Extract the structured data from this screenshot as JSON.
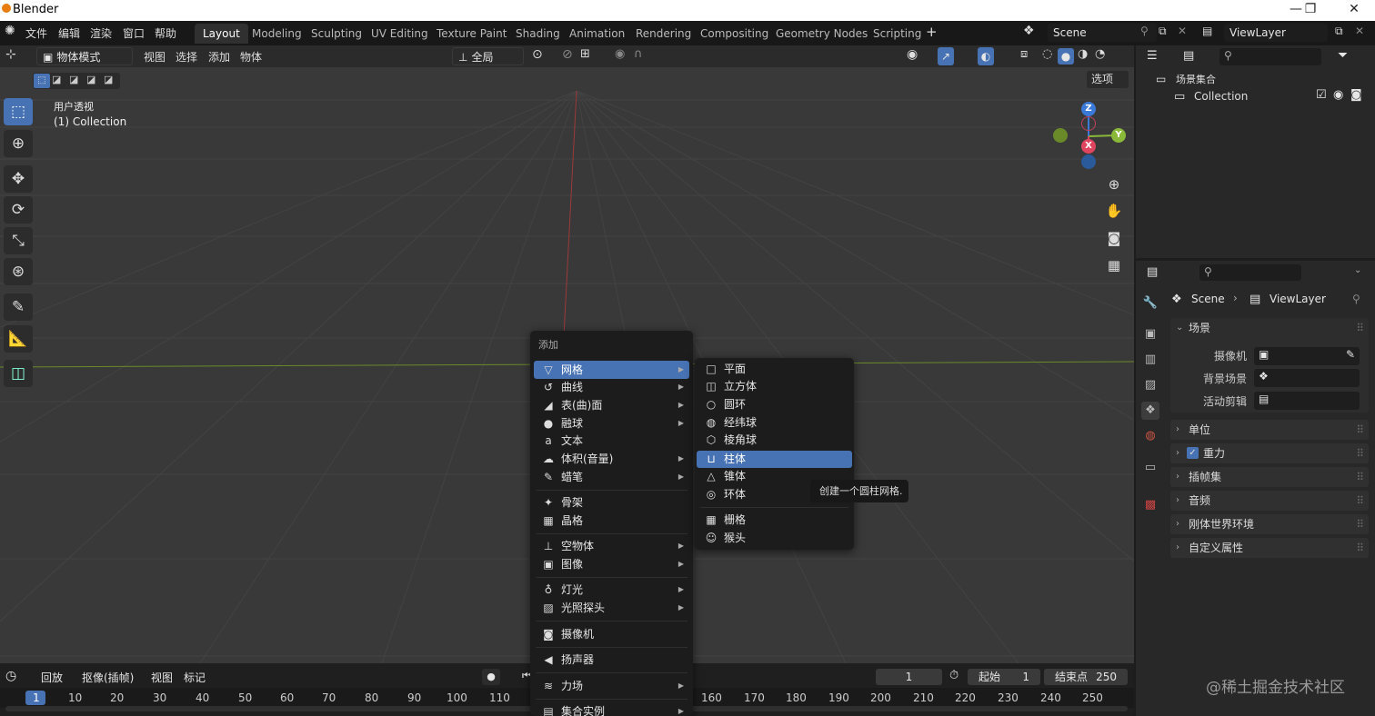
{
  "window": {
    "title": "Blender",
    "controls": [
      "—",
      "❐",
      "✕"
    ]
  },
  "menubar": {
    "items": [
      "文件",
      "编辑",
      "渲染",
      "窗口",
      "帮助"
    ]
  },
  "workspaces": [
    {
      "label": "Layout",
      "active": true
    },
    {
      "label": "Modeling"
    },
    {
      "label": "Sculpting"
    },
    {
      "label": "UV Editing"
    },
    {
      "label": "Texture Paint"
    },
    {
      "label": "Shading"
    },
    {
      "label": "Animation"
    },
    {
      "label": "Rendering"
    },
    {
      "label": "Compositing"
    },
    {
      "label": "Geometry Nodes"
    },
    {
      "label": "Scripting"
    }
  ],
  "scene": {
    "name": "Scene"
  },
  "viewlayer": {
    "name": "ViewLayer"
  },
  "viewport_header": {
    "mode": "物体模式",
    "menus": [
      "视图",
      "选择",
      "添加",
      "物体"
    ],
    "transform_orientation": "全局",
    "options": "选项"
  },
  "viewport": {
    "view_name": "用户透视",
    "collection_label": "(1) Collection"
  },
  "gizmo": {
    "z": "Z",
    "y": "Y",
    "x": "X"
  },
  "timeline": {
    "playback": "回放",
    "keying": "抠像(插帧)",
    "menus": [
      "视图",
      "标记"
    ],
    "current_frame": "1",
    "start_label": "起始",
    "start": "1",
    "end_label": "结束点",
    "end": "250",
    "frame_ticks": [
      "1",
      "10",
      "20",
      "30",
      "40",
      "50",
      "60",
      "70",
      "80",
      "90",
      "100",
      "110",
      "160",
      "170",
      "180",
      "190",
      "200",
      "210",
      "220",
      "230",
      "240",
      "250"
    ]
  },
  "outliner": {
    "scene_collection": "场景集合",
    "collection": "Collection"
  },
  "properties": {
    "breadcrumb_scene": "Scene",
    "breadcrumb_layer": "ViewLayer",
    "scene_panel": "场景",
    "camera_label": "摄像机",
    "bg_scene_label": "背景场景",
    "active_clip_label": "活动剪辑",
    "panels": [
      "单位",
      "重力",
      "插帧集",
      "音频",
      "刚体世界环境",
      "自定义属性"
    ]
  },
  "add_menu": {
    "title": "添加",
    "items": [
      {
        "label": "网格",
        "icon": "▽",
        "sub": true,
        "highlight": true
      },
      {
        "label": "曲线",
        "icon": "↺",
        "sub": true
      },
      {
        "label": "表(曲)面",
        "icon": "◢",
        "sub": true
      },
      {
        "label": "融球",
        "icon": "●",
        "sub": true
      },
      {
        "label": "文本",
        "icon": "a",
        "sub": false
      },
      {
        "label": "体积(音量)",
        "icon": "☁",
        "sub": true
      },
      {
        "label": "蜡笔",
        "icon": "✎",
        "sub": true
      },
      {
        "label": "骨架",
        "icon": "✦",
        "sub": false
      },
      {
        "label": "晶格",
        "icon": "▦",
        "sub": false
      },
      {
        "label": "空物体",
        "icon": "⊥",
        "sub": true
      },
      {
        "label": "图像",
        "icon": "▣",
        "sub": true
      },
      {
        "label": "灯光",
        "icon": "♁",
        "sub": true
      },
      {
        "label": "光照探头",
        "icon": "▨",
        "sub": true
      },
      {
        "label": "摄像机",
        "icon": "◙",
        "sub": false
      },
      {
        "label": "扬声器",
        "icon": "◀",
        "sub": false
      },
      {
        "label": "力场",
        "icon": "≋",
        "sub": true
      },
      {
        "label": "集合实例",
        "icon": "▤",
        "sub": true
      }
    ]
  },
  "mesh_submenu": {
    "items": [
      {
        "label": "平面",
        "icon": "□"
      },
      {
        "label": "立方体",
        "icon": "◫"
      },
      {
        "label": "圆环",
        "icon": "○"
      },
      {
        "label": "经纬球",
        "icon": "◍"
      },
      {
        "label": "棱角球",
        "icon": "⬡"
      },
      {
        "label": "柱体",
        "icon": "⊔",
        "highlight": true
      },
      {
        "label": "锥体",
        "icon": "△"
      },
      {
        "label": "环体",
        "icon": "◎"
      },
      {
        "label": "栅格",
        "icon": "▦"
      },
      {
        "label": "猴头",
        "icon": "☺"
      }
    ]
  },
  "tooltip": "创建一个圆柱网格.",
  "watermark": "@稀土掘金技术社区"
}
